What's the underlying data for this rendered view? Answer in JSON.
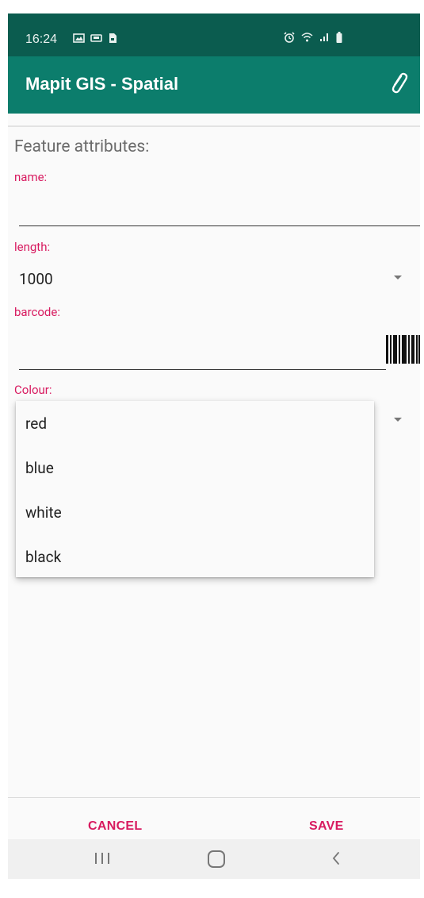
{
  "status_bar": {
    "time": "16:24",
    "left_icons": [
      "image-icon",
      "car-icon",
      "sim-icon"
    ],
    "right_icons": [
      "alarm-icon",
      "wifi-icon",
      "signal-icon",
      "battery-icon"
    ]
  },
  "app_bar": {
    "title": "Mapit GIS - Spatial",
    "action_icon": "paperclip-icon"
  },
  "form": {
    "section_title": "Feature attributes:",
    "fields": {
      "name": {
        "label": "name:",
        "value": ""
      },
      "length": {
        "label": "length:",
        "value": "1000"
      },
      "barcode": {
        "label": "barcode:",
        "value": "",
        "icon": "barcode-icon"
      },
      "colour": {
        "label": "Colour:",
        "value": ""
      }
    }
  },
  "dropdown": {
    "options": [
      "red",
      "blue",
      "white",
      "black"
    ]
  },
  "actions": {
    "cancel_label": "CANCEL",
    "save_label": "SAVE"
  },
  "navigation": {
    "icons": [
      "recent-apps-icon",
      "home-icon",
      "back-icon"
    ]
  },
  "colors": {
    "status_bar": "#0b5c4f",
    "app_bar": "#0c7d6c",
    "accent": "#d81b60"
  }
}
